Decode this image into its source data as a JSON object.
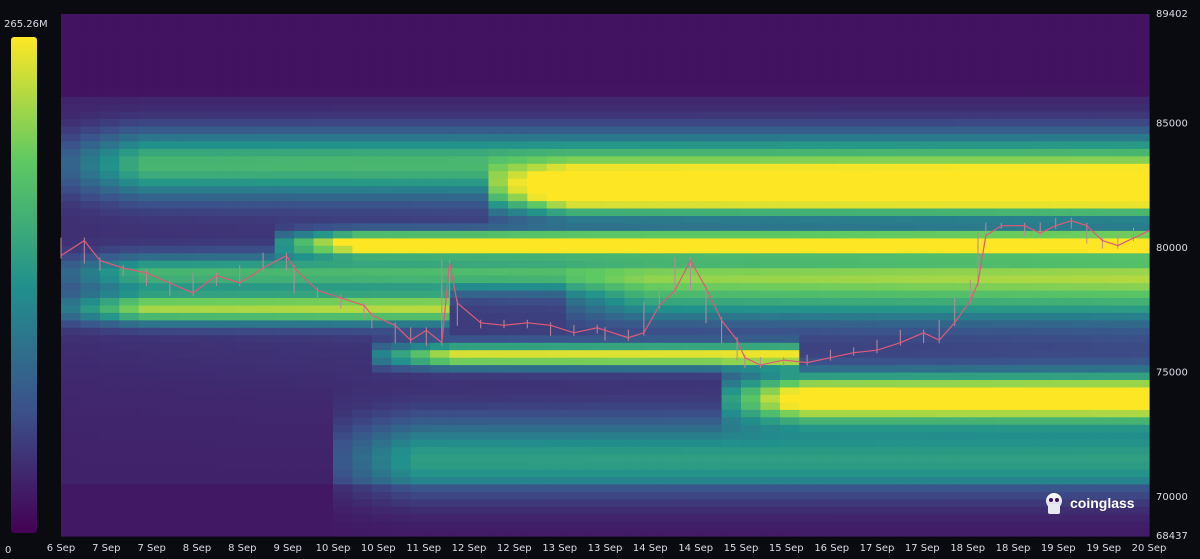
{
  "chart_data": {
    "type": "heatmap",
    "title": "",
    "xlabel": "",
    "ylabel": "",
    "brand": "coinglass",
    "x_ticks": [
      "6 Sep",
      "7 Sep",
      "7 Sep",
      "8 Sep",
      "8 Sep",
      "9 Sep",
      "10 Sep",
      "10 Sep",
      "11 Sep",
      "12 Sep",
      "12 Sep",
      "13 Sep",
      "13 Sep",
      "14 Sep",
      "14 Sep",
      "15 Sep",
      "15 Sep",
      "16 Sep",
      "17 Sep",
      "17 Sep",
      "18 Sep",
      "18 Sep",
      "19 Sep",
      "19 Sep",
      "20 Sep"
    ],
    "x_range": [
      "6 Sep",
      "20 Sep"
    ],
    "y_ticks": [
      "89402",
      "85000",
      "80000",
      "75000",
      "70000",
      "68437"
    ],
    "y_range": [
      68437,
      89402
    ],
    "colorbar": {
      "max_label": "265.26M",
      "min_label": "0",
      "colors": [
        "#440154",
        "#3b528b",
        "#21918c",
        "#5ec962",
        "#fde725"
      ]
    },
    "price_series": [
      {
        "day": 0.0,
        "price": 79700
      },
      {
        "day": 0.3,
        "price": 80300
      },
      {
        "day": 0.5,
        "price": 79500
      },
      {
        "day": 0.8,
        "price": 79200
      },
      {
        "day": 1.1,
        "price": 79000
      },
      {
        "day": 1.4,
        "price": 78600
      },
      {
        "day": 1.7,
        "price": 78200
      },
      {
        "day": 2.0,
        "price": 78900
      },
      {
        "day": 2.3,
        "price": 78600
      },
      {
        "day": 2.6,
        "price": 79200
      },
      {
        "day": 2.9,
        "price": 79700
      },
      {
        "day": 3.0,
        "price": 79200
      },
      {
        "day": 3.3,
        "price": 78300
      },
      {
        "day": 3.6,
        "price": 78000
      },
      {
        "day": 3.9,
        "price": 77700
      },
      {
        "day": 4.0,
        "price": 77300
      },
      {
        "day": 4.3,
        "price": 76900
      },
      {
        "day": 4.5,
        "price": 76300
      },
      {
        "day": 4.7,
        "price": 76700
      },
      {
        "day": 4.9,
        "price": 76200
      },
      {
        "day": 5.0,
        "price": 79400
      },
      {
        "day": 5.1,
        "price": 77800
      },
      {
        "day": 5.4,
        "price": 77000
      },
      {
        "day": 5.7,
        "price": 76900
      },
      {
        "day": 6.0,
        "price": 77000
      },
      {
        "day": 6.3,
        "price": 76900
      },
      {
        "day": 6.6,
        "price": 76600
      },
      {
        "day": 6.9,
        "price": 76800
      },
      {
        "day": 7.0,
        "price": 76700
      },
      {
        "day": 7.3,
        "price": 76400
      },
      {
        "day": 7.5,
        "price": 76600
      },
      {
        "day": 7.7,
        "price": 77700
      },
      {
        "day": 7.9,
        "price": 78300
      },
      {
        "day": 8.1,
        "price": 79500
      },
      {
        "day": 8.3,
        "price": 78400
      },
      {
        "day": 8.5,
        "price": 77100
      },
      {
        "day": 8.7,
        "price": 76300
      },
      {
        "day": 8.8,
        "price": 75600
      },
      {
        "day": 9.0,
        "price": 75300
      },
      {
        "day": 9.3,
        "price": 75500
      },
      {
        "day": 9.6,
        "price": 75400
      },
      {
        "day": 9.9,
        "price": 75600
      },
      {
        "day": 10.2,
        "price": 75800
      },
      {
        "day": 10.5,
        "price": 75900
      },
      {
        "day": 10.8,
        "price": 76200
      },
      {
        "day": 11.1,
        "price": 76600
      },
      {
        "day": 11.3,
        "price": 76300
      },
      {
        "day": 11.5,
        "price": 77000
      },
      {
        "day": 11.7,
        "price": 77900
      },
      {
        "day": 11.8,
        "price": 78600
      },
      {
        "day": 11.9,
        "price": 80500
      },
      {
        "day": 12.1,
        "price": 80900
      },
      {
        "day": 12.4,
        "price": 80900
      },
      {
        "day": 12.6,
        "price": 80600
      },
      {
        "day": 12.8,
        "price": 80900
      },
      {
        "day": 13.0,
        "price": 81100
      },
      {
        "day": 13.2,
        "price": 80900
      },
      {
        "day": 13.4,
        "price": 80300
      },
      {
        "day": 13.6,
        "price": 80100
      },
      {
        "day": 13.8,
        "price": 80400
      },
      {
        "day": 14.0,
        "price": 80700
      }
    ]
  }
}
